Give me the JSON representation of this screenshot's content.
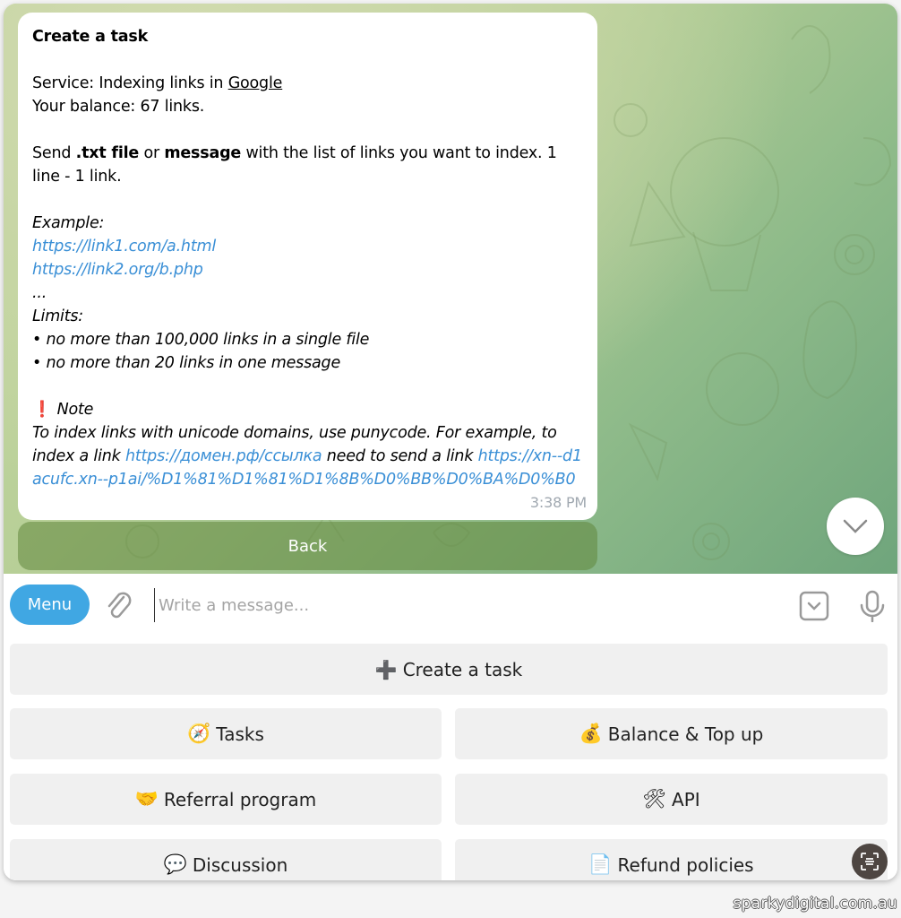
{
  "message": {
    "title": "Create a task",
    "service_prefix": "Service: Indexing links in ",
    "service_name": "Google",
    "balance": "Your balance: 67 links.",
    "send_1": "Send ",
    "send_txt": ".txt file",
    "send_2": " or ",
    "send_msg": "message",
    "send_3": " with the list of links you want to index. 1 line - 1 link.",
    "example_label": "Example:",
    "example_links": [
      "https://link1.com/a.html",
      "https://link2.org/b.php"
    ],
    "ellipsis": "...",
    "limits_label": "Limits:",
    "limits": [
      "• no more than 100,000 links in a single file",
      "• no more than 20 links in one message"
    ],
    "note_icon": "❗",
    "note_label": "Note",
    "note_1": "To index links with unicode domains, use punycode. For example, to index a link ",
    "note_link_1": "https://домен.рф/ссылка",
    "note_2": " need to send a link ",
    "note_link_2": "https://xn--d1acufc.xn--p1ai/%D1%81%D1%81%D1%8B%D0%BB%D0%BA%D0%B0",
    "time": "3:38 PM"
  },
  "inline_button": {
    "label": "Back"
  },
  "composer": {
    "menu_label": "Menu",
    "placeholder": "Write a message...",
    "value": ""
  },
  "keyboard": {
    "buttons": [
      {
        "icon": "➕",
        "label": "Create a task"
      },
      {
        "icon": "🧭",
        "label": "Tasks"
      },
      {
        "icon": "💰",
        "label": "Balance & Top up"
      },
      {
        "icon": "🤝",
        "label": "Referral program"
      },
      {
        "icon": "🛠",
        "label": "API"
      },
      {
        "icon": "💬",
        "label": "Discussion"
      },
      {
        "icon": "📄",
        "label": "Refund policies"
      }
    ]
  },
  "watermark": "sparkydigital.com.au"
}
